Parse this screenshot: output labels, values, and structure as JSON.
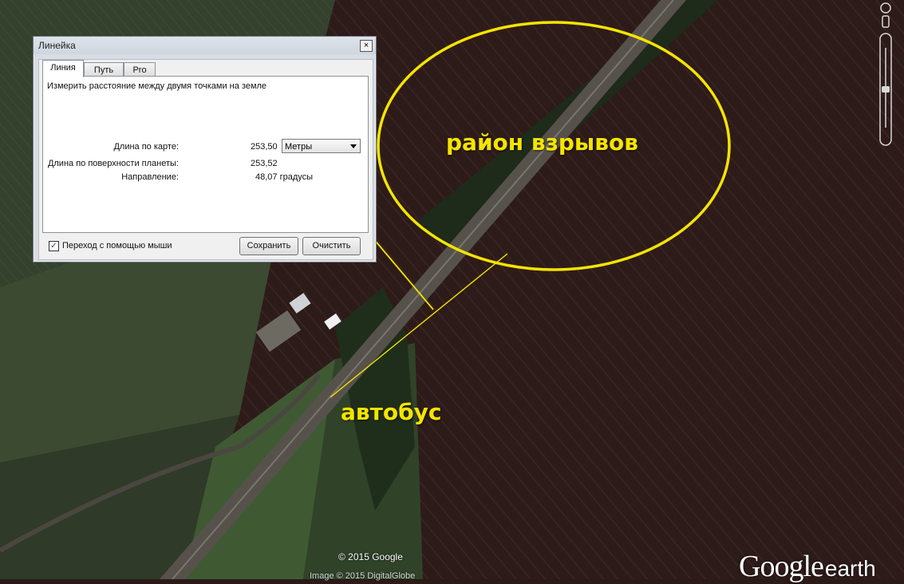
{
  "ruler": {
    "title": "Линейка",
    "close_glyph": "×",
    "tabs": [
      "Линия",
      "Путь",
      "Pro"
    ],
    "description": "Измерить расстояние между двумя точками на земле",
    "map_length_label": "Длина по карте:",
    "map_length_value": "253,50",
    "unit_selected": "Метры",
    "surface_length_label": "Длина по поверхности планеты:",
    "surface_length_value": "253,52",
    "direction_label": "Направление:",
    "direction_value": "48,07 градусы",
    "mouse_nav_label": "Переход с помощью мыши",
    "mouse_nav_checked": true,
    "save_label": "Сохранить",
    "clear_label": "Очистить"
  },
  "annotations": {
    "explosion_area": "район взрывов",
    "bus": "автобус",
    "color": "#f5e400"
  },
  "map": {
    "copyright": "© 2015 Google",
    "copyright_secondary": "Image © 2015 DigitalGlobe",
    "logo_main": "Google",
    "logo_small": "earth"
  }
}
